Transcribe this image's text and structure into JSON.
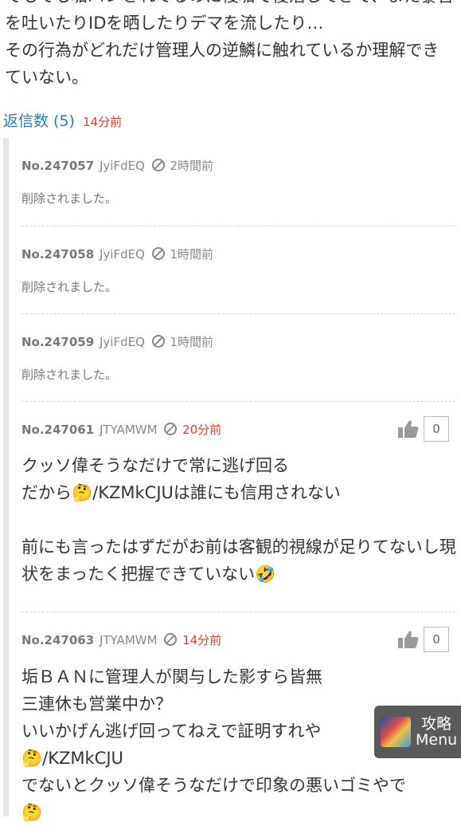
{
  "post": {
    "lines": [
      "でもでも垢バンされてるのに複垢で復活してきて、また暴言を吐いたりIDを晒したりデマを流したり…",
      "その行為がどれだけ管理人の逆鱗に触れているか理解できていない。"
    ]
  },
  "reply_bar": {
    "label": "返信数 (5)",
    "time": "14分前"
  },
  "replies": [
    {
      "no": "No.247057",
      "id": "JyiFdEQ",
      "time": "2時間前",
      "deleted": "削除されました。"
    },
    {
      "no": "No.247058",
      "id": "JyiFdEQ",
      "time": "1時間前",
      "deleted": "削除されました。"
    },
    {
      "no": "No.247059",
      "id": "JyiFdEQ",
      "time": "1時間前",
      "deleted": "削除されました。"
    },
    {
      "no": "No.247061",
      "id": "JTYAMWM",
      "time": "20分前",
      "likes": "0",
      "lines": [
        "クッソ偉そうなだけで常に逃げ回る",
        "だから🤔/KZMkCJUは誰にも信用されない",
        "",
        "前にも言ったはずだがお前は客観的視線が足りてないし現状をまったく把握できていない🤣"
      ]
    },
    {
      "no": "No.247063",
      "id": "JTYAMWM",
      "time": "14分前",
      "likes": "0",
      "lines": [
        "垢ＢＡＮに管理人が関与した影すら皆無",
        "三連休も営業中か？",
        "いいかげん逃げ回ってねえで証明すれや",
        "🤔/KZMkCJU",
        "でないとクッソ偉そうなだけで印象の悪いゴミやで",
        "🤔"
      ]
    }
  ],
  "menu": {
    "line1": "攻略",
    "line2": "Menu"
  },
  "colors": {
    "link": "#2a7ab5",
    "red": "#e23b2e",
    "menu_bg": "#5a5a5a"
  }
}
